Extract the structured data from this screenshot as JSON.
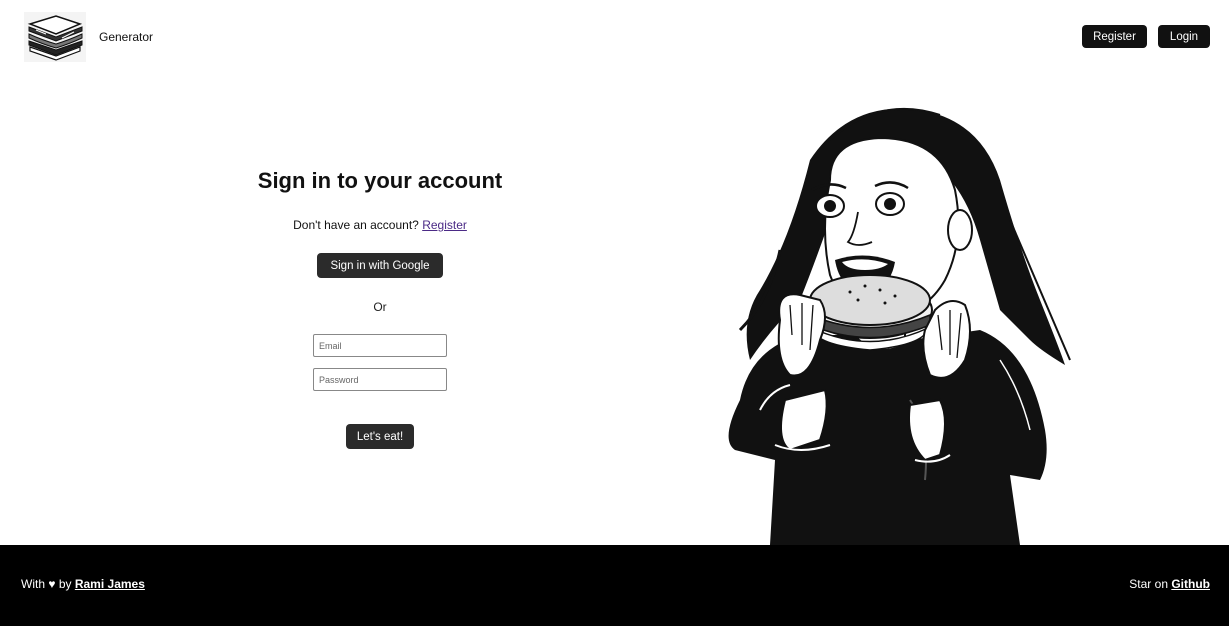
{
  "header": {
    "brand": "Generator",
    "register_label": "Register",
    "login_label": "Login"
  },
  "form": {
    "title": "Sign in to your account",
    "no_account_text": "Don't have an account?",
    "register_link": "Register",
    "google_button": "Sign in with Google",
    "or_text": "Or",
    "email_placeholder": "Email",
    "password_placeholder": "Password",
    "submit_label": "Let's eat!"
  },
  "footer": {
    "with_text": "With",
    "heart_icon": "♥",
    "by_text": "by",
    "author_link": "Rami James",
    "star_text": "Star on",
    "github_link": "Github"
  },
  "colors": {
    "button_bg": "#2b2b2b",
    "footer_bg": "#000000",
    "link_color": "#4b2a86"
  }
}
